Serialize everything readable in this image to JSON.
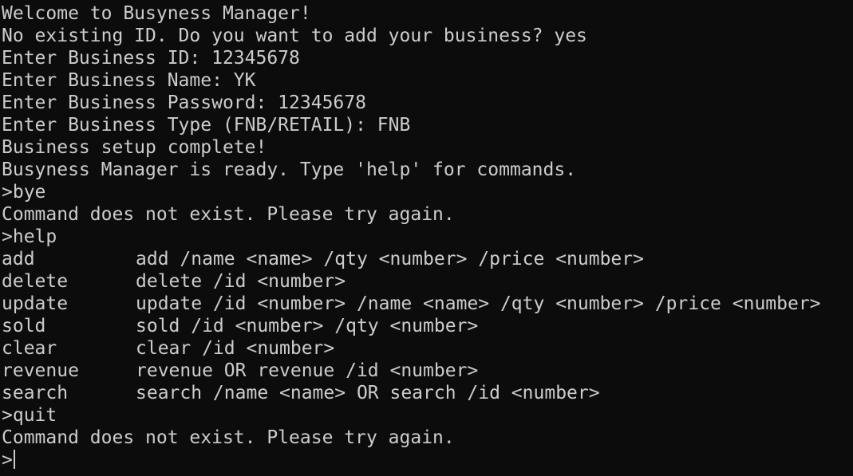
{
  "theme": {
    "background": "#0c0c0c",
    "foreground": "#cccccc"
  },
  "output": {
    "welcome": "Welcome to Busyness Manager!",
    "no_id_prompt": "No existing ID. Do you want to add your business? yes",
    "enter_id": "Enter Business ID: 12345678",
    "enter_name": "Enter Business Name: YK",
    "enter_password": "Enter Business Password: 12345678",
    "enter_type": "Enter Business Type (FNB/RETAIL): FNB",
    "setup_complete": "Business setup complete!",
    "ready": "Busyness Manager is ready. Type 'help' for commands.",
    "input_bye": ">bye",
    "error_1": "Command does not exist. Please try again.",
    "input_help": ">help",
    "help_commands": [
      {
        "name": "add",
        "usage": "add /name <name> /qty <number> /price <number>"
      },
      {
        "name": "delete",
        "usage": "delete /id <number>"
      },
      {
        "name": "update",
        "usage": "update /id <number> /name <name> /qty <number> /price <number>"
      },
      {
        "name": "sold",
        "usage": "sold /id <number> /qty <number>"
      },
      {
        "name": "clear",
        "usage": "clear /id <number>"
      },
      {
        "name": "revenue",
        "usage": "revenue OR revenue /id <number>"
      },
      {
        "name": "search",
        "usage": "search /name <name> OR search /id <number>"
      }
    ],
    "input_quit": ">quit",
    "error_2": "Command does not exist. Please try again.",
    "prompt": ">"
  }
}
